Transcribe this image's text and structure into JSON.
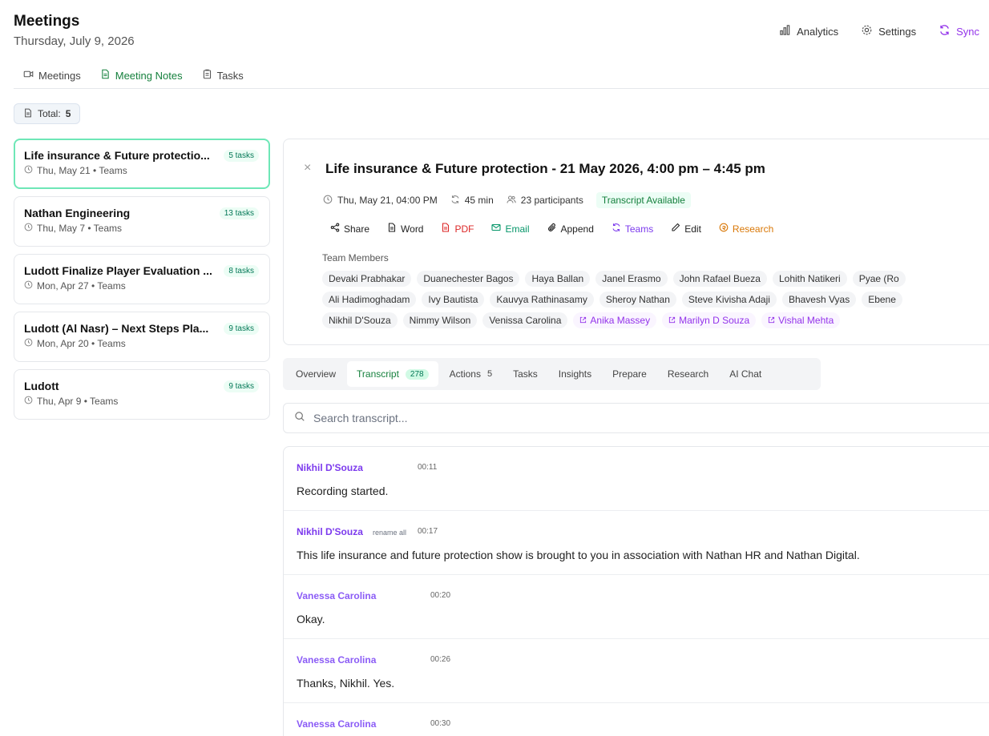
{
  "header": {
    "title": "Meetings",
    "date": "Thursday, July 9, 2026",
    "analytics_label": "Analytics",
    "settings_label": "Settings",
    "sync_label": "Sync"
  },
  "nav": {
    "meetings_label": "Meetings",
    "notes_label": "Meeting Notes",
    "tasks_label": "Tasks"
  },
  "total": {
    "label": "Total:",
    "count": "5"
  },
  "meetings": [
    {
      "title": "Life insurance & Future protectio...",
      "sub": "Thu, May 21 • Teams",
      "badge": "5 tasks"
    },
    {
      "title": "Nathan Engineering",
      "sub": "Thu, May 7 • Teams",
      "badge": "13 tasks"
    },
    {
      "title": "Ludott Finalize Player Evaluation ...",
      "sub": "Mon, Apr 27 • Teams",
      "badge": "8 tasks"
    },
    {
      "title": "Ludott (Al Nasr) – Next Steps Pla...",
      "sub": "Mon, Apr 20 • Teams",
      "badge": "9 tasks"
    },
    {
      "title": "Ludott",
      "sub": "Thu, Apr 9 • Teams",
      "badge": "9 tasks"
    }
  ],
  "detail": {
    "close": "×",
    "title": "Life insurance & Future protection - 21 May 2026, 4:00 pm – 4:45 pm",
    "datetime": "Thu, May 21, 04:00 PM",
    "duration": "45 min",
    "participants": "23 participants",
    "transcript_status": "Transcript Available",
    "actions": {
      "share": "Share",
      "word": "Word",
      "pdf": "PDF",
      "email": "Email",
      "append": "Append",
      "teams": "Teams",
      "edit": "Edit",
      "research": "Research"
    },
    "members_label": "Team Members",
    "members_row1": [
      "Devaki Prabhakar",
      "Duanechester Bagos",
      "Haya Ballan",
      "Janel Erasmo",
      "John Rafael Bueza",
      "Lohith Natikeri",
      "Pyae (Ro"
    ],
    "members_row2": [
      "Ali Hadimoghadam",
      "Ivy Bautista",
      "Kauvya Rathinasamy",
      "Sheroy Nathan",
      "Steve Kivisha Adaji",
      "Bhavesh Vyas",
      "Ebene"
    ],
    "members_row3": [
      "Nikhil D'Souza",
      "Nimmy Wilson",
      "Venissa Carolina"
    ],
    "external_members": [
      "Anika Massey",
      "Marilyn D Souza",
      "Vishal Mehta"
    ]
  },
  "tabs": {
    "overview": "Overview",
    "transcript": "Transcript",
    "transcript_count": "278",
    "actions": "Actions",
    "actions_count": "5",
    "tasks": "Tasks",
    "insights": "Insights",
    "prepare": "Prepare",
    "research": "Research",
    "ai_chat": "AI Chat"
  },
  "search": {
    "placeholder": "Search transcript..."
  },
  "transcript": [
    {
      "speaker": "Nikhil D'Souza",
      "time": "00:11",
      "text": "Recording started.",
      "rename": ""
    },
    {
      "speaker": "Nikhil D'Souza",
      "time": "00:17",
      "text": "This life insurance and future protection show is brought to you in association with Nathan HR and Nathan Digital.",
      "rename": "rename all"
    },
    {
      "speaker": "Vanessa Carolina",
      "time": "00:20",
      "text": "Okay.",
      "rename": ""
    },
    {
      "speaker": "Vanessa Carolina",
      "time": "00:26",
      "text": "Thanks, Nikhil. Yes.",
      "rename": ""
    },
    {
      "speaker": "Vanessa Carolina",
      "time": "00:30",
      "text": "",
      "rename": ""
    }
  ],
  "colors": {
    "accent": "#15803d",
    "speaker": "#7c3aed",
    "sync": "#9333ea"
  }
}
